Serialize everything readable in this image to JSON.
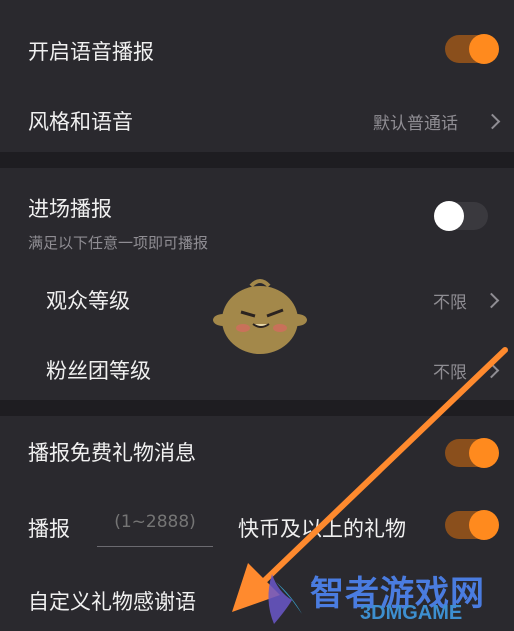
{
  "voice_broadcast": {
    "label": "开启语音播报",
    "enabled": true
  },
  "style_voice": {
    "label": "风格和语音",
    "value": "默认普通话"
  },
  "entry_broadcast": {
    "label": "进场播报",
    "subtitle": "满足以下任意一项即可播报",
    "enabled": false
  },
  "audience_level": {
    "label": "观众等级",
    "value": "不限"
  },
  "fan_club_level": {
    "label": "粉丝团等级",
    "value": "不限"
  },
  "free_gift_broadcast": {
    "label": "播报免费礼物消息",
    "enabled": true
  },
  "gift_threshold": {
    "prefix": "播报",
    "placeholder": "(1~2888)",
    "suffix": "快币及以上的礼物",
    "enabled": true
  },
  "custom_thanks": {
    "label": "自定义礼物感谢语"
  },
  "watermark": {
    "text": "智者游戏网",
    "sub": "3DMGAME"
  },
  "colors": {
    "accent": "#ff8a1e",
    "panel": "#2a292e",
    "background": "#1b1b1f"
  }
}
